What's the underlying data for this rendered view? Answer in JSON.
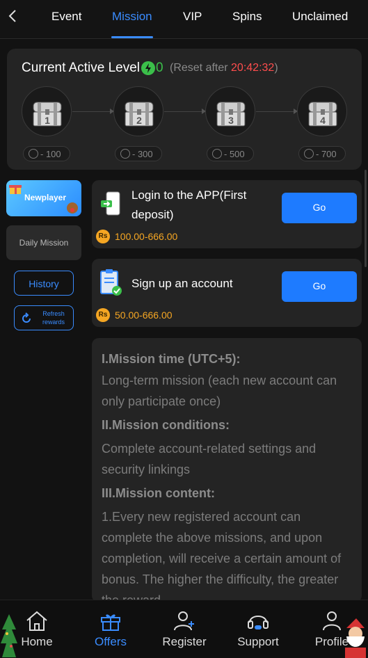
{
  "tabs": [
    {
      "label": "Event",
      "active": false
    },
    {
      "label": "Mission",
      "active": true
    },
    {
      "label": "VIP",
      "active": false
    },
    {
      "label": "Spins",
      "active": false
    },
    {
      "label": "Unclaimed",
      "active": false
    }
  ],
  "level": {
    "title": "Current Active Level",
    "value": "0",
    "reset_prefix": "(Reset after ",
    "reset_time": "20:42:32",
    "reset_suffix": ")",
    "chests": [
      {
        "num": "1",
        "points": "- 100"
      },
      {
        "num": "2",
        "points": "- 300"
      },
      {
        "num": "3",
        "points": "- 500"
      },
      {
        "num": "4",
        "points": "- 700"
      }
    ]
  },
  "sidebar": {
    "newplayer": "Newplayer",
    "daily": "Daily Mission",
    "history": "History",
    "refresh": "Refresh rewards"
  },
  "missions": [
    {
      "title_line1": "Login to the APP(First",
      "title_line2": "deposit)",
      "button": "Go",
      "currency": "Rs",
      "reward": "100.00-666.00"
    },
    {
      "title_line1": "Sign up an account",
      "title_line2": "",
      "button": "Go",
      "currency": "Rs",
      "reward": "50.00-666.00"
    }
  ],
  "description": {
    "h1": "I.Mission time (UTC+5):",
    "p1a": "Long-term mission (each new account can",
    "p1b": "only participate once)",
    "h2": "II.Mission conditions:",
    "p2a": "Complete account-related settings and",
    "p2b": "security linkings",
    "h3": "III.Mission content:",
    "p3a": "1.Every new registered account can",
    "p3b": "complete the above missions, and upon",
    "p3c": "completion, will receive a certain amount of",
    "p3d": "bonus. The higher the difficulty, the greater",
    "p3e": "the reward."
  },
  "bottom_nav": [
    {
      "label": "Home",
      "icon": "home-icon",
      "active": false
    },
    {
      "label": "Offers",
      "icon": "gift-icon",
      "active": true
    },
    {
      "label": "Register",
      "icon": "add-user-icon",
      "active": false
    },
    {
      "label": "Support",
      "icon": "headset-icon",
      "active": false
    },
    {
      "label": "Profile",
      "icon": "person-icon",
      "active": false
    }
  ],
  "colors": {
    "accent": "#3a8cff",
    "go_button": "#1e7bff",
    "reward": "#f5a623",
    "level_green": "#3bbf4a",
    "timer_red": "#ff4d4d"
  }
}
